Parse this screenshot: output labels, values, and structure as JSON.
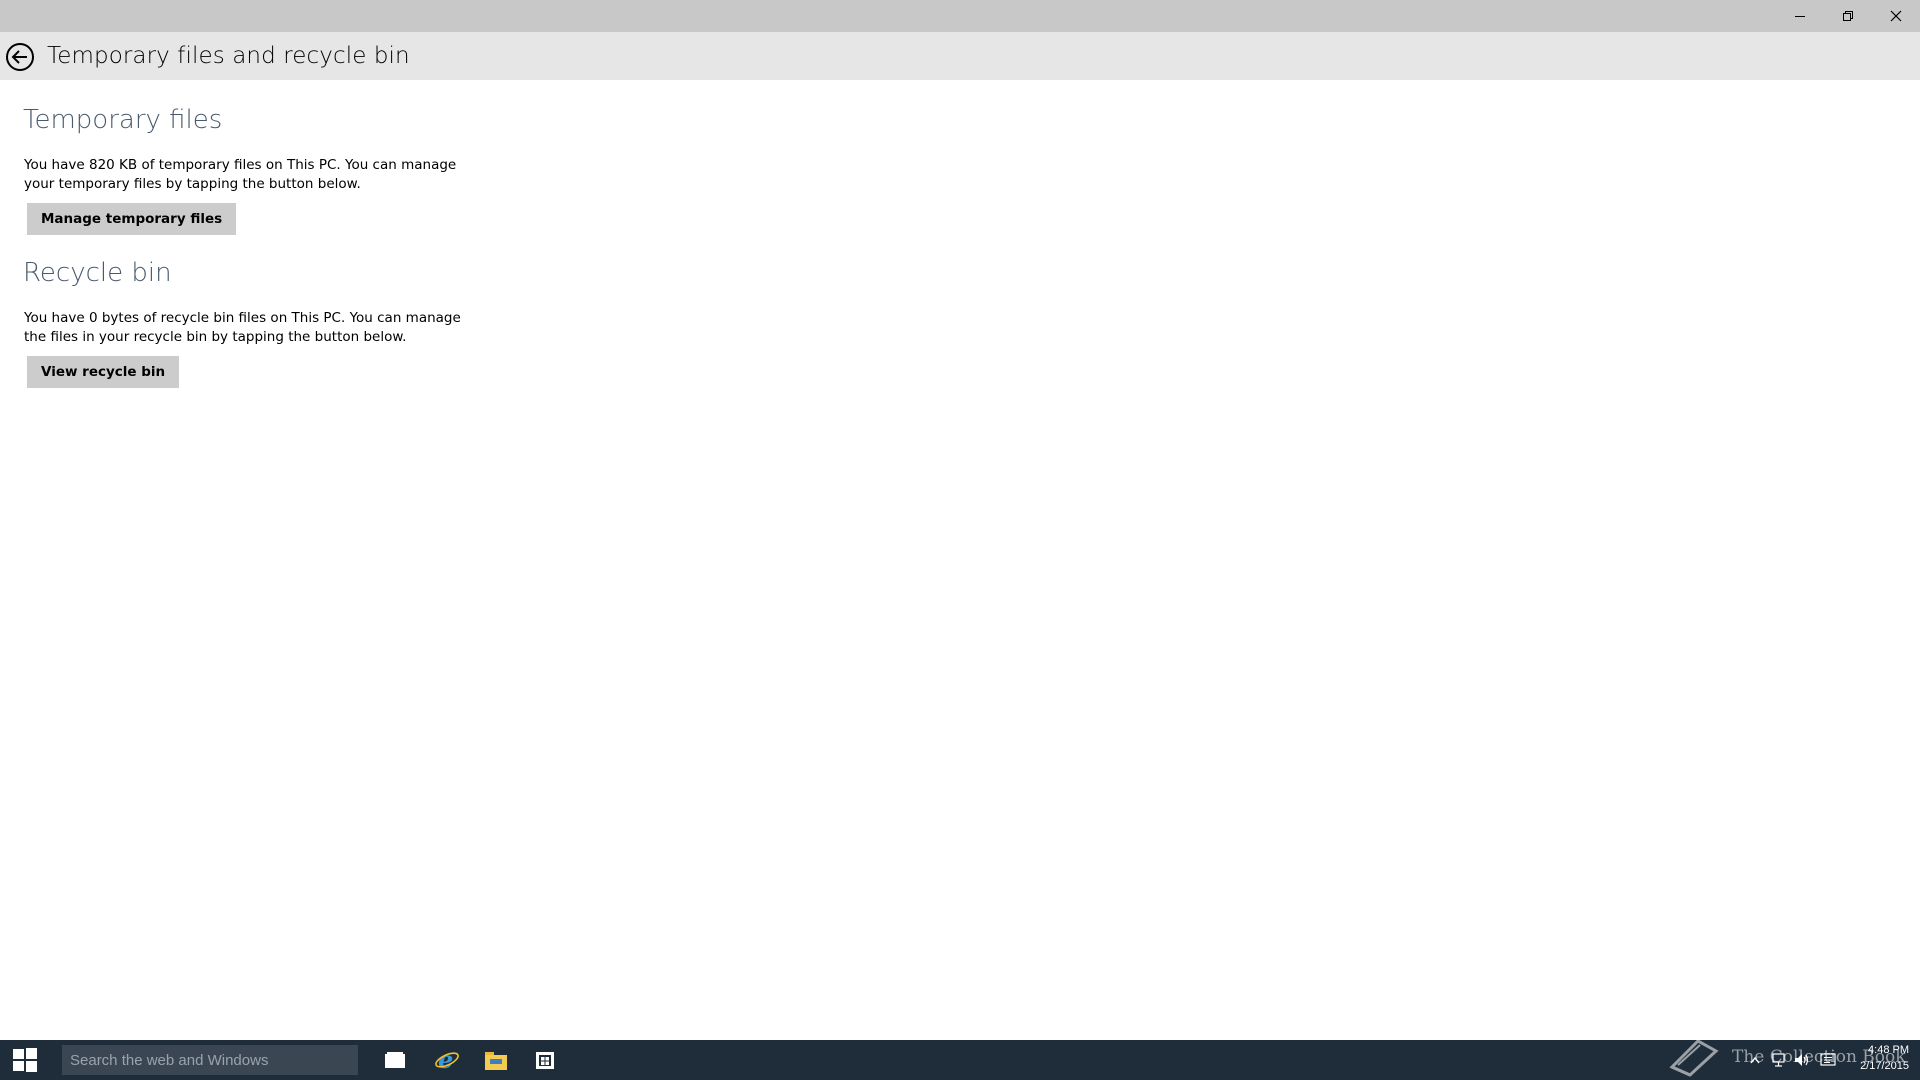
{
  "window": {
    "controls": [
      "minimize",
      "restore",
      "close"
    ]
  },
  "header": {
    "title": "Temporary files and recycle bin"
  },
  "temporary_files": {
    "heading": "Temporary files",
    "description": "You have 820 KB of temporary files on This PC. You can manage your temporary files by tapping the button below.",
    "button_label": "Manage temporary files"
  },
  "recycle_bin": {
    "heading": "Recycle bin",
    "description": "You have 0 bytes of recycle bin files on This PC. You can manage the files in your recycle bin by tapping the button below.",
    "button_label": "View recycle bin"
  },
  "taskbar": {
    "search_placeholder": "Search the web and Windows",
    "pinned": [
      "task-view-icon",
      "internet-explorer-icon",
      "file-explorer-icon",
      "store-icon"
    ],
    "tray_icons": [
      "chevron-up-icon",
      "network-icon",
      "volume-icon",
      "action-center-icon"
    ],
    "time": "4:48 PM",
    "date": "2/17/2015"
  },
  "watermark": {
    "text": "The Collection Book"
  },
  "colors": {
    "titlebar": "#c8c8c8",
    "header": "#e6e6e6",
    "heading": "#4a5a6e",
    "button": "#cccccc",
    "taskbar": "#1f2c3a"
  }
}
